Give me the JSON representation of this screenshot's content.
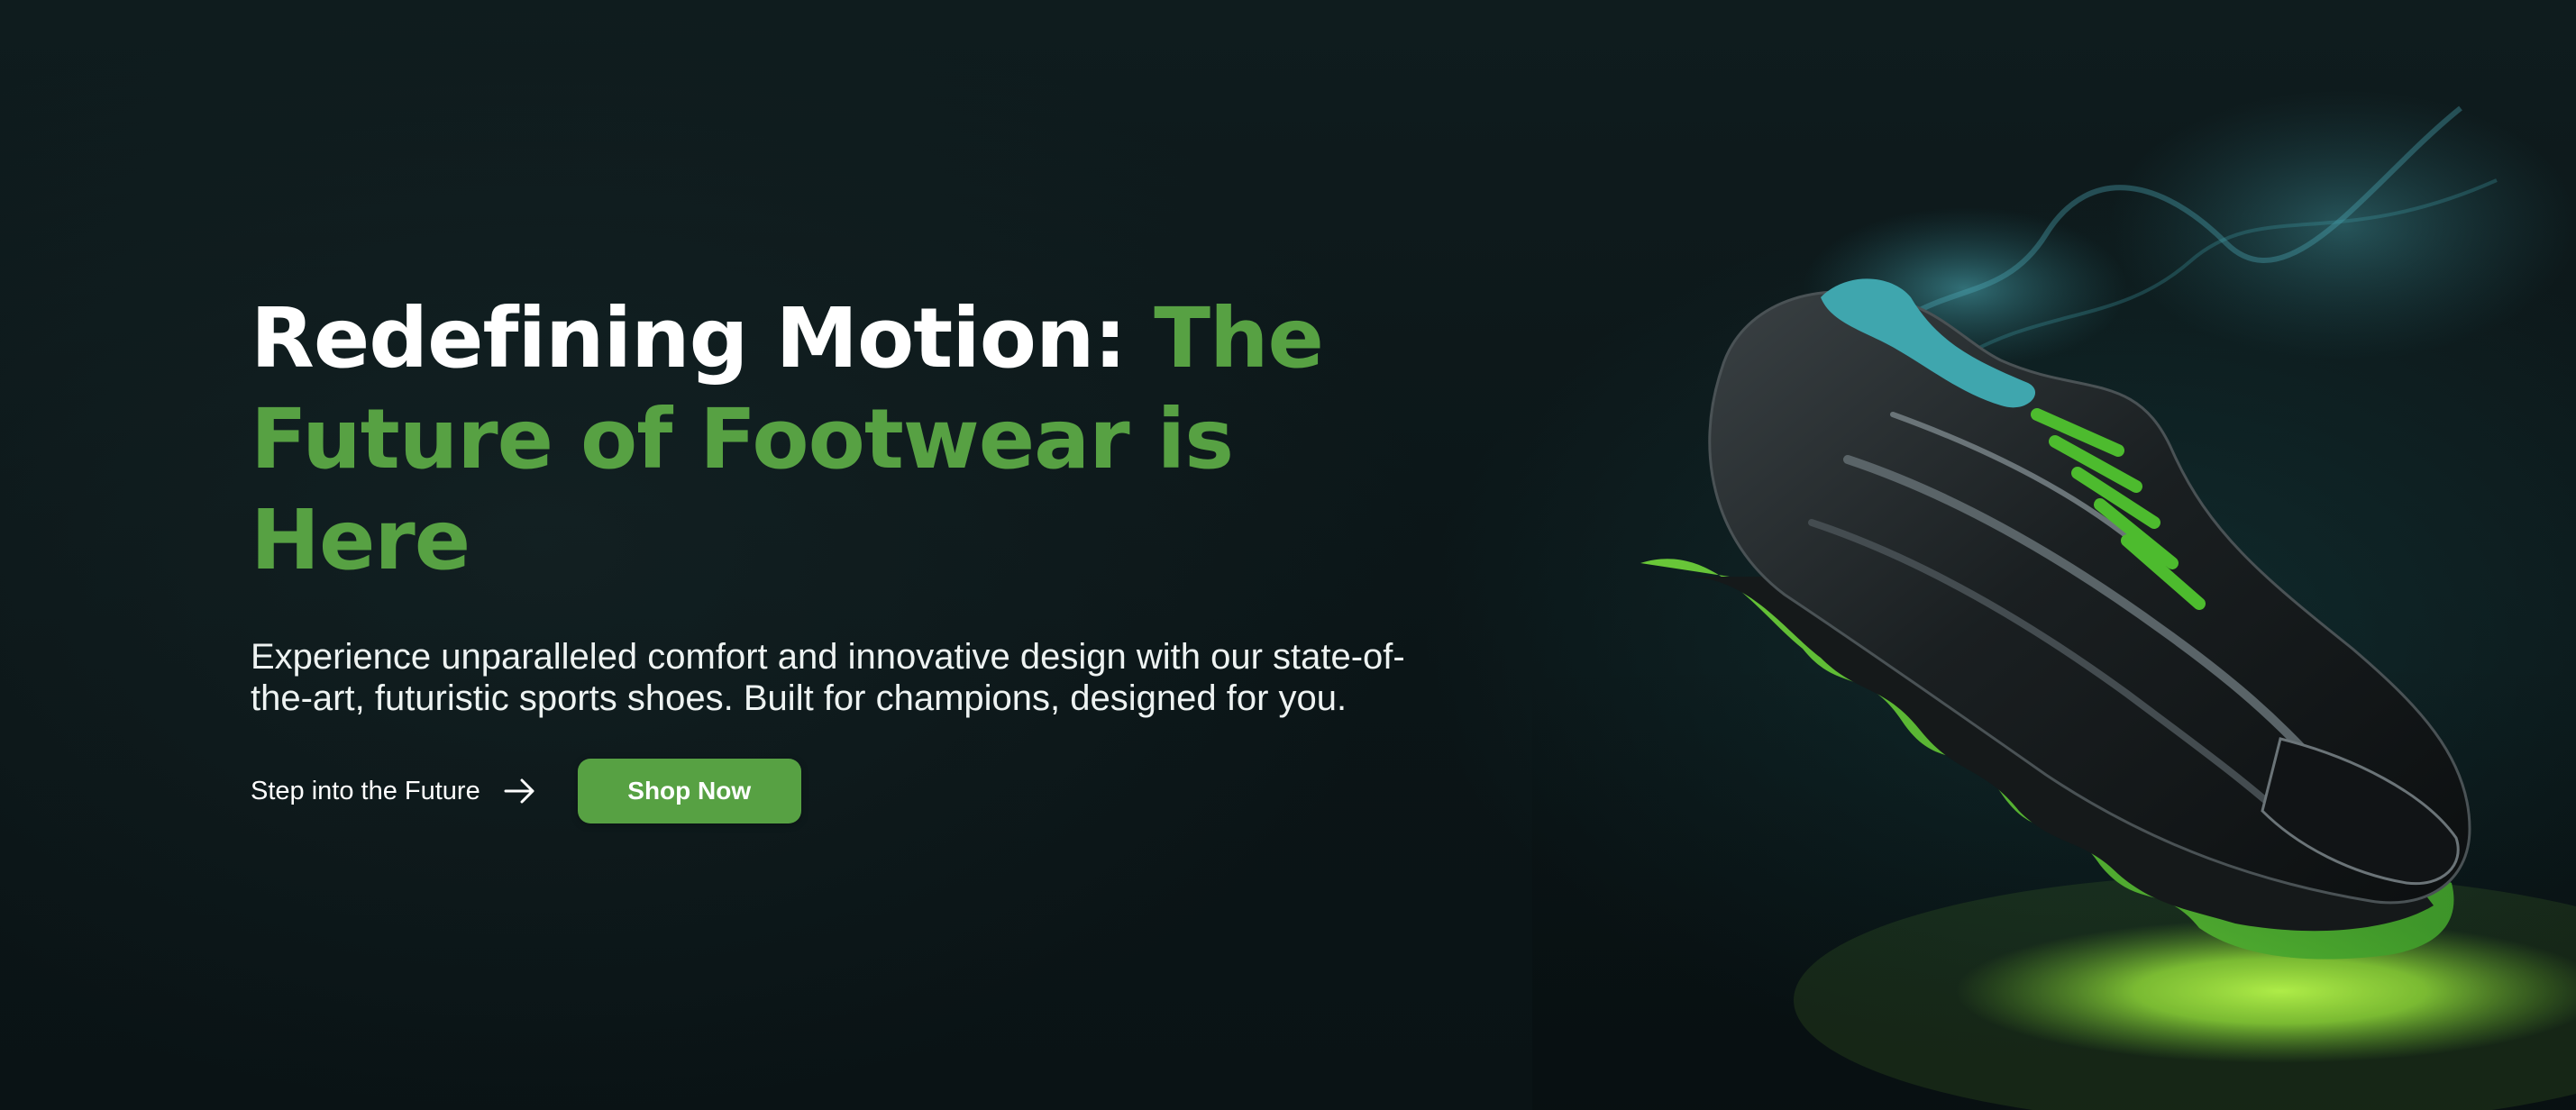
{
  "hero": {
    "headline_main": "Redefining Motion: ",
    "headline_accent": "The Future of Footwear is Here",
    "description": "Experience unparalleled comfort and innovative design with our state-of-the-art, futuristic sports shoes. Built for champions, designed for you.",
    "secondary_cta_label": "Step into the Future",
    "secondary_cta_icon": "arrow-right-icon",
    "primary_cta_label": "Shop Now"
  },
  "colors": {
    "background": "#0c1719",
    "accent_green": "#57a143",
    "neon_glow": "#9be33a",
    "teal_smoke": "#3f9aa6",
    "text_primary": "#ffffff"
  },
  "image": {
    "subject_icon": "sneaker-icon"
  }
}
